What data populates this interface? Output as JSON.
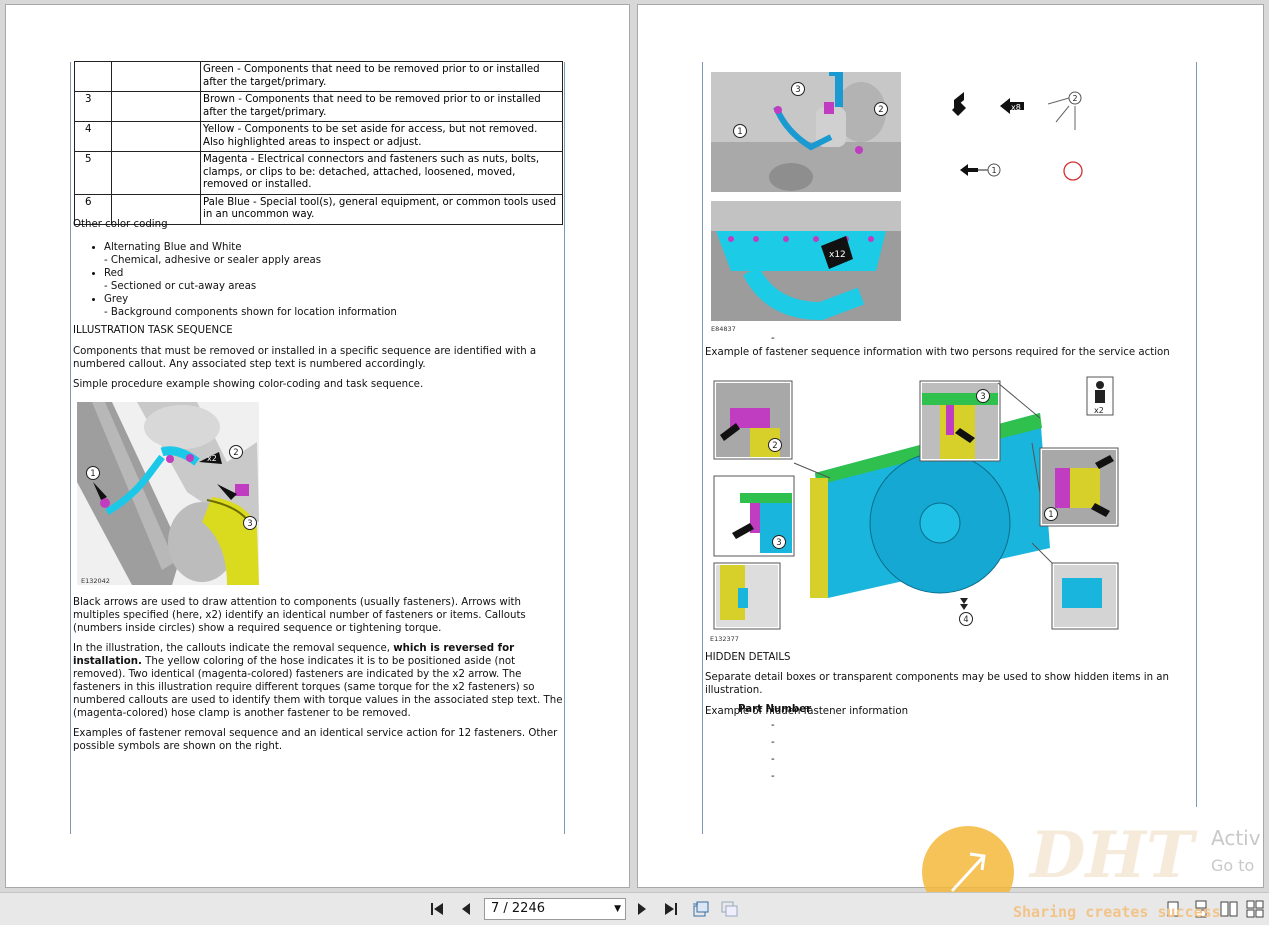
{
  "left_page": {
    "table_rows": [
      {
        "num": "",
        "desc": "Green - Components that need to be removed prior to or installed after the target/primary."
      },
      {
        "num": "3",
        "desc": "Brown - Components that need to be removed prior to or installed after the target/primary."
      },
      {
        "num": "4",
        "desc": "Yellow - Components to be set aside for access, but not removed. Also highlighted areas to inspect or adjust."
      },
      {
        "num": "5",
        "desc": "Magenta - Electrical connectors and fasteners such as nuts, bolts, clamps, or clips to be: detached, attached, loosened, moved, removed or installed."
      },
      {
        "num": "6",
        "desc": "Pale Blue - Special tool(s), general equipment, or common tools used in an uncommon way."
      }
    ],
    "other_color_heading": "Other color coding",
    "bullets": [
      {
        "title": "Alternating Blue and White",
        "desc": "- Chemical, adhesive or sealer apply areas"
      },
      {
        "title": "Red",
        "desc": "- Sectioned or cut-away areas"
      },
      {
        "title": "Grey",
        "desc": "- Background components shown for location information"
      }
    ],
    "seq_heading": "ILLUSTRATION TASK SEQUENCE",
    "seq_para": "Components that must be removed or installed in a specific sequence are identified with a numbered callout. Any associated step text is numbered accordingly.",
    "simple_para": "Simple procedure example showing color-coding and task sequence.",
    "figure_label": "E132042",
    "figure_callouts": [
      "1",
      "2",
      "3"
    ],
    "figure_arrow_label": "x2",
    "arrows_para": "Black arrows are used to draw attention to components (usually fasteners). Arrows with multiples specified (here, x2) identify an identical number of fasteners or items. Callouts (numbers inside circles) show a required sequence or tightening torque.",
    "callouts_para_a": "In the illustration, the callouts indicate the removal sequence, ",
    "callouts_para_bold": "which is reversed for installation.",
    "callouts_para_b": " The yellow coloring of the hose indicates it is to be positioned aside (not removed). Two identical (magenta-colored) fasteners are indicated by the x2 arrow. The fasteners in this illustration require different torques (same torque for the x2 fasteners) so numbered callouts are used to identify them with torque values in the associated step text. The (magenta-colored) hose clamp is another fastener to be removed.",
    "examples_para": "Examples of fastener removal sequence and an identical service action for 12 fasteners. Other possible symbols are shown on the right."
  },
  "right_page": {
    "top_fig_callouts": [
      "3",
      "2",
      "1"
    ],
    "top_fig2_label": "x12",
    "fig_label_1": "E84837",
    "symbols": {
      "x8": "x8",
      "two": "2",
      "one": "1"
    },
    "dash": "-",
    "two_persons_para": "Example of fastener sequence information with two persons required for the service action",
    "fig2_label": "E132377",
    "fig2_callouts": [
      "2",
      "3",
      "3",
      "1",
      "4"
    ],
    "persons_badge": "x2",
    "hidden_heading": "HIDDEN DETAILS",
    "hidden_para": "Separate detail boxes or transparent components may be used to show hidden items in an illustration.",
    "example_line": "Example of hidden fastener information",
    "part_number_header": "Part Number",
    "dashes": [
      "-",
      "-",
      "-",
      "-"
    ]
  },
  "toolbar": {
    "page_field": "7 / 2246"
  },
  "watermark": {
    "brand": "DHT",
    "tagline": "Sharing creates success",
    "activate_1": "Activ",
    "activate_2": "Go to"
  }
}
